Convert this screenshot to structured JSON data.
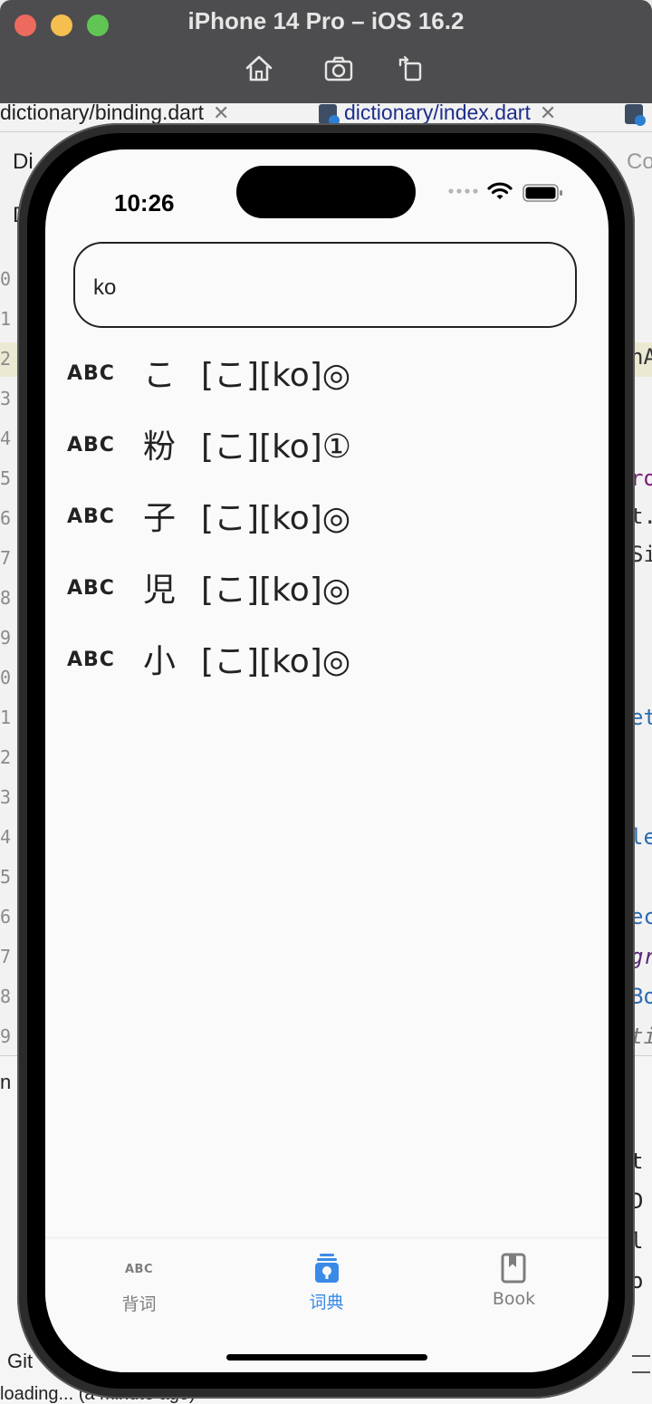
{
  "simulator": {
    "title": "iPhone 14 Pro – iOS 16.2",
    "toolbar_icons": [
      "home-icon",
      "screenshot-icon",
      "rotate-icon"
    ]
  },
  "ide": {
    "tabs": [
      {
        "label": "dictionary/binding.dart"
      },
      {
        "label": "dictionary/index.dart"
      }
    ],
    "gutter_numbers": [
      "0",
      "1",
      "2",
      "3",
      "4",
      "5",
      "6",
      "7",
      "8",
      "9",
      "0",
      "1",
      "2",
      "3",
      "4",
      "5",
      "6",
      "7",
      "8",
      "9"
    ],
    "bottom_left_labels": [
      "Git",
      "loading... (a minute ago)"
    ]
  },
  "phone": {
    "status_bar": {
      "time": "10:26"
    },
    "search": {
      "value": "ko",
      "placeholder": ""
    },
    "results": [
      {
        "word": "こ",
        "reading": "[こ][ko]◎"
      },
      {
        "word": "粉",
        "reading": "[こ][ko]①"
      },
      {
        "word": "子",
        "reading": "[こ][ko]◎"
      },
      {
        "word": "児",
        "reading": "[こ][ko]◎"
      },
      {
        "word": "小",
        "reading": "[こ][ko]◎"
      }
    ],
    "result_icon": "abc-icon",
    "bottom_nav": [
      {
        "label": "背词",
        "icon": "abc-icon",
        "active": false
      },
      {
        "label": "词典",
        "icon": "dictionary-icon",
        "active": true
      },
      {
        "label": "Book",
        "icon": "book-icon",
        "active": false
      }
    ],
    "colors": {
      "accent": "#3b8ae6",
      "inactive": "#7d7d7d",
      "text": "#222222",
      "background": "#fafafa"
    }
  }
}
